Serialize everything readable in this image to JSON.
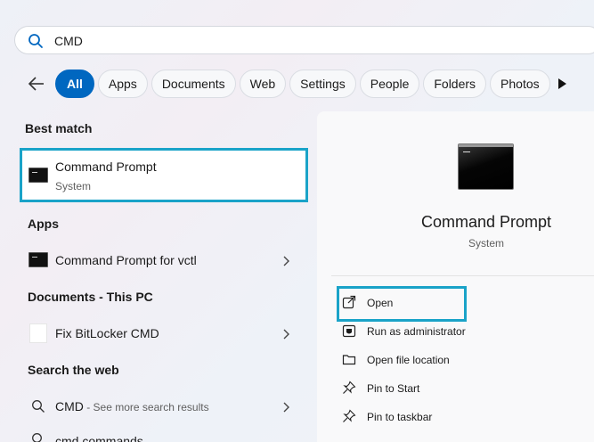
{
  "search": {
    "value": "CMD"
  },
  "filters": {
    "tabs": [
      {
        "label": "All",
        "active": true
      },
      {
        "label": "Apps"
      },
      {
        "label": "Documents"
      },
      {
        "label": "Web"
      },
      {
        "label": "Settings"
      },
      {
        "label": "People"
      },
      {
        "label": "Folders"
      },
      {
        "label": "Photos"
      }
    ]
  },
  "sections": {
    "best_match": "Best match",
    "apps": "Apps",
    "documents": "Documents - This PC",
    "web": "Search the web"
  },
  "best_match": {
    "title": "Command Prompt",
    "subtitle": "System"
  },
  "apps": [
    {
      "label": "Command Prompt for vctl"
    }
  ],
  "documents": [
    {
      "label": "Fix BitLocker CMD"
    }
  ],
  "web": [
    {
      "label": "CMD",
      "suffix": " - See more search results"
    },
    {
      "label": "cmd commands"
    }
  ],
  "details": {
    "title": "Command Prompt",
    "subtitle": "System",
    "actions": [
      {
        "label": "Open",
        "icon": "open-external-icon"
      },
      {
        "label": "Run as administrator",
        "icon": "shield-run-icon"
      },
      {
        "label": "Open file location",
        "icon": "folder-icon"
      },
      {
        "label": "Pin to Start",
        "icon": "pin-icon"
      },
      {
        "label": "Pin to taskbar",
        "icon": "pin-icon"
      }
    ]
  },
  "colors": {
    "accent": "#0067c0",
    "highlight": "#1aa3c8"
  }
}
